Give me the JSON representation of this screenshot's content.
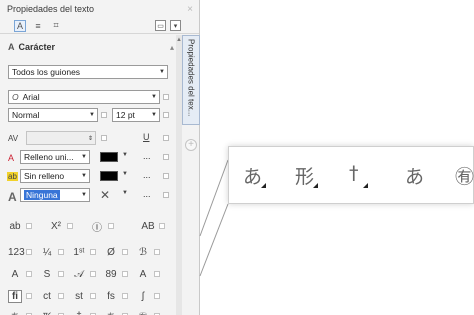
{
  "panel": {
    "title": "Propiedades del texto",
    "close_glyph": "×",
    "vertical_tab_label": "Propiedades del tex..."
  },
  "tabs": [
    {
      "name": "character-tab",
      "glyph": "A"
    },
    {
      "name": "paragraph-tab",
      "glyph": "≡"
    },
    {
      "name": "frame-tab",
      "glyph": "⌗"
    }
  ],
  "character": {
    "section_label": "Carácter",
    "section_icon": "A",
    "script_value": "Todos los guiones",
    "font_value": "Arial",
    "font_icon": "O",
    "style_value": "Normal",
    "size_value": "12 pt",
    "kerning_icon": "AV",
    "underline_icon": "U",
    "fill_icon": "A",
    "fill_value": "Relleno uni...",
    "bg_icon": "ab",
    "bg_value": "Sin relleno",
    "outline_icon": "A",
    "outline_value": "Ninguna",
    "more_glyph": "..."
  },
  "glyph_rows": [
    [
      "ab",
      "X²",
      "Ⓘ",
      "AB"
    ],
    [
      "123",
      "¼",
      "1ˢᵗ",
      "Ø",
      "ℬ"
    ],
    [
      "A",
      "S",
      "𝒜",
      "89",
      "A"
    ],
    [
      "fi",
      "ct",
      "st",
      "fs",
      "ʃ"
    ],
    [
      "あ",
      "形",
      "†",
      "あ",
      "㊒"
    ]
  ],
  "zoom_glyphs": [
    "あ",
    "形",
    "†",
    "あ",
    "㊒"
  ],
  "colors": {
    "panel_bg": "#f3f3f3",
    "accent": "#3875d7",
    "vtab_bg": "#e5ecf5"
  }
}
